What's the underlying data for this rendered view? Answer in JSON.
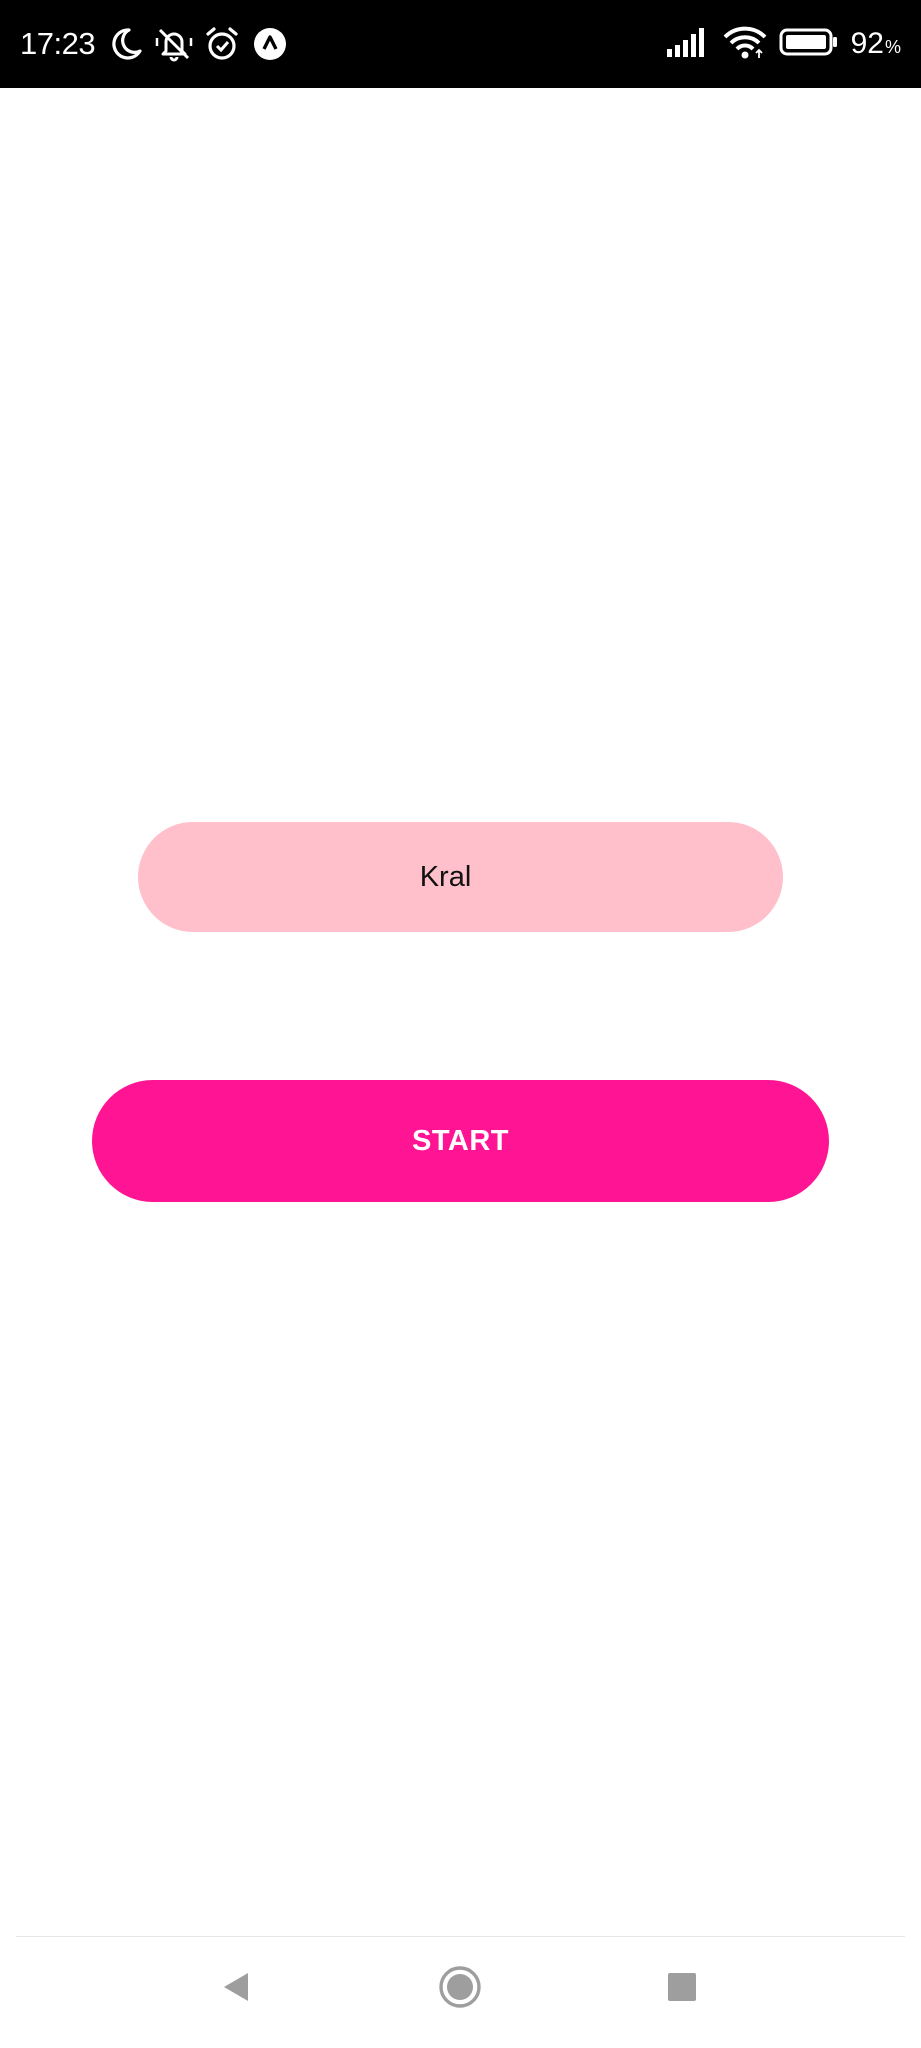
{
  "status_bar": {
    "time": "17:23",
    "left_icons": [
      "moon-icon",
      "notifications-off-icon",
      "alarm-icon",
      "app-notification-icon"
    ],
    "right_icons": [
      "signal-icon",
      "wifi-icon",
      "battery-icon"
    ],
    "battery_percent": "92",
    "battery_percent_sign": "%"
  },
  "form": {
    "name_value": "Kral",
    "start_label": "START"
  },
  "colors": {
    "status_bar_bg": "#000000",
    "name_field_bg": "#ffc0cb",
    "start_button_bg": "#ff1493",
    "start_text": "#ffffff",
    "nav_icon": "#9e9e9e"
  },
  "nav_bar": {
    "icons": [
      "back-icon",
      "home-icon",
      "recents-icon"
    ]
  }
}
